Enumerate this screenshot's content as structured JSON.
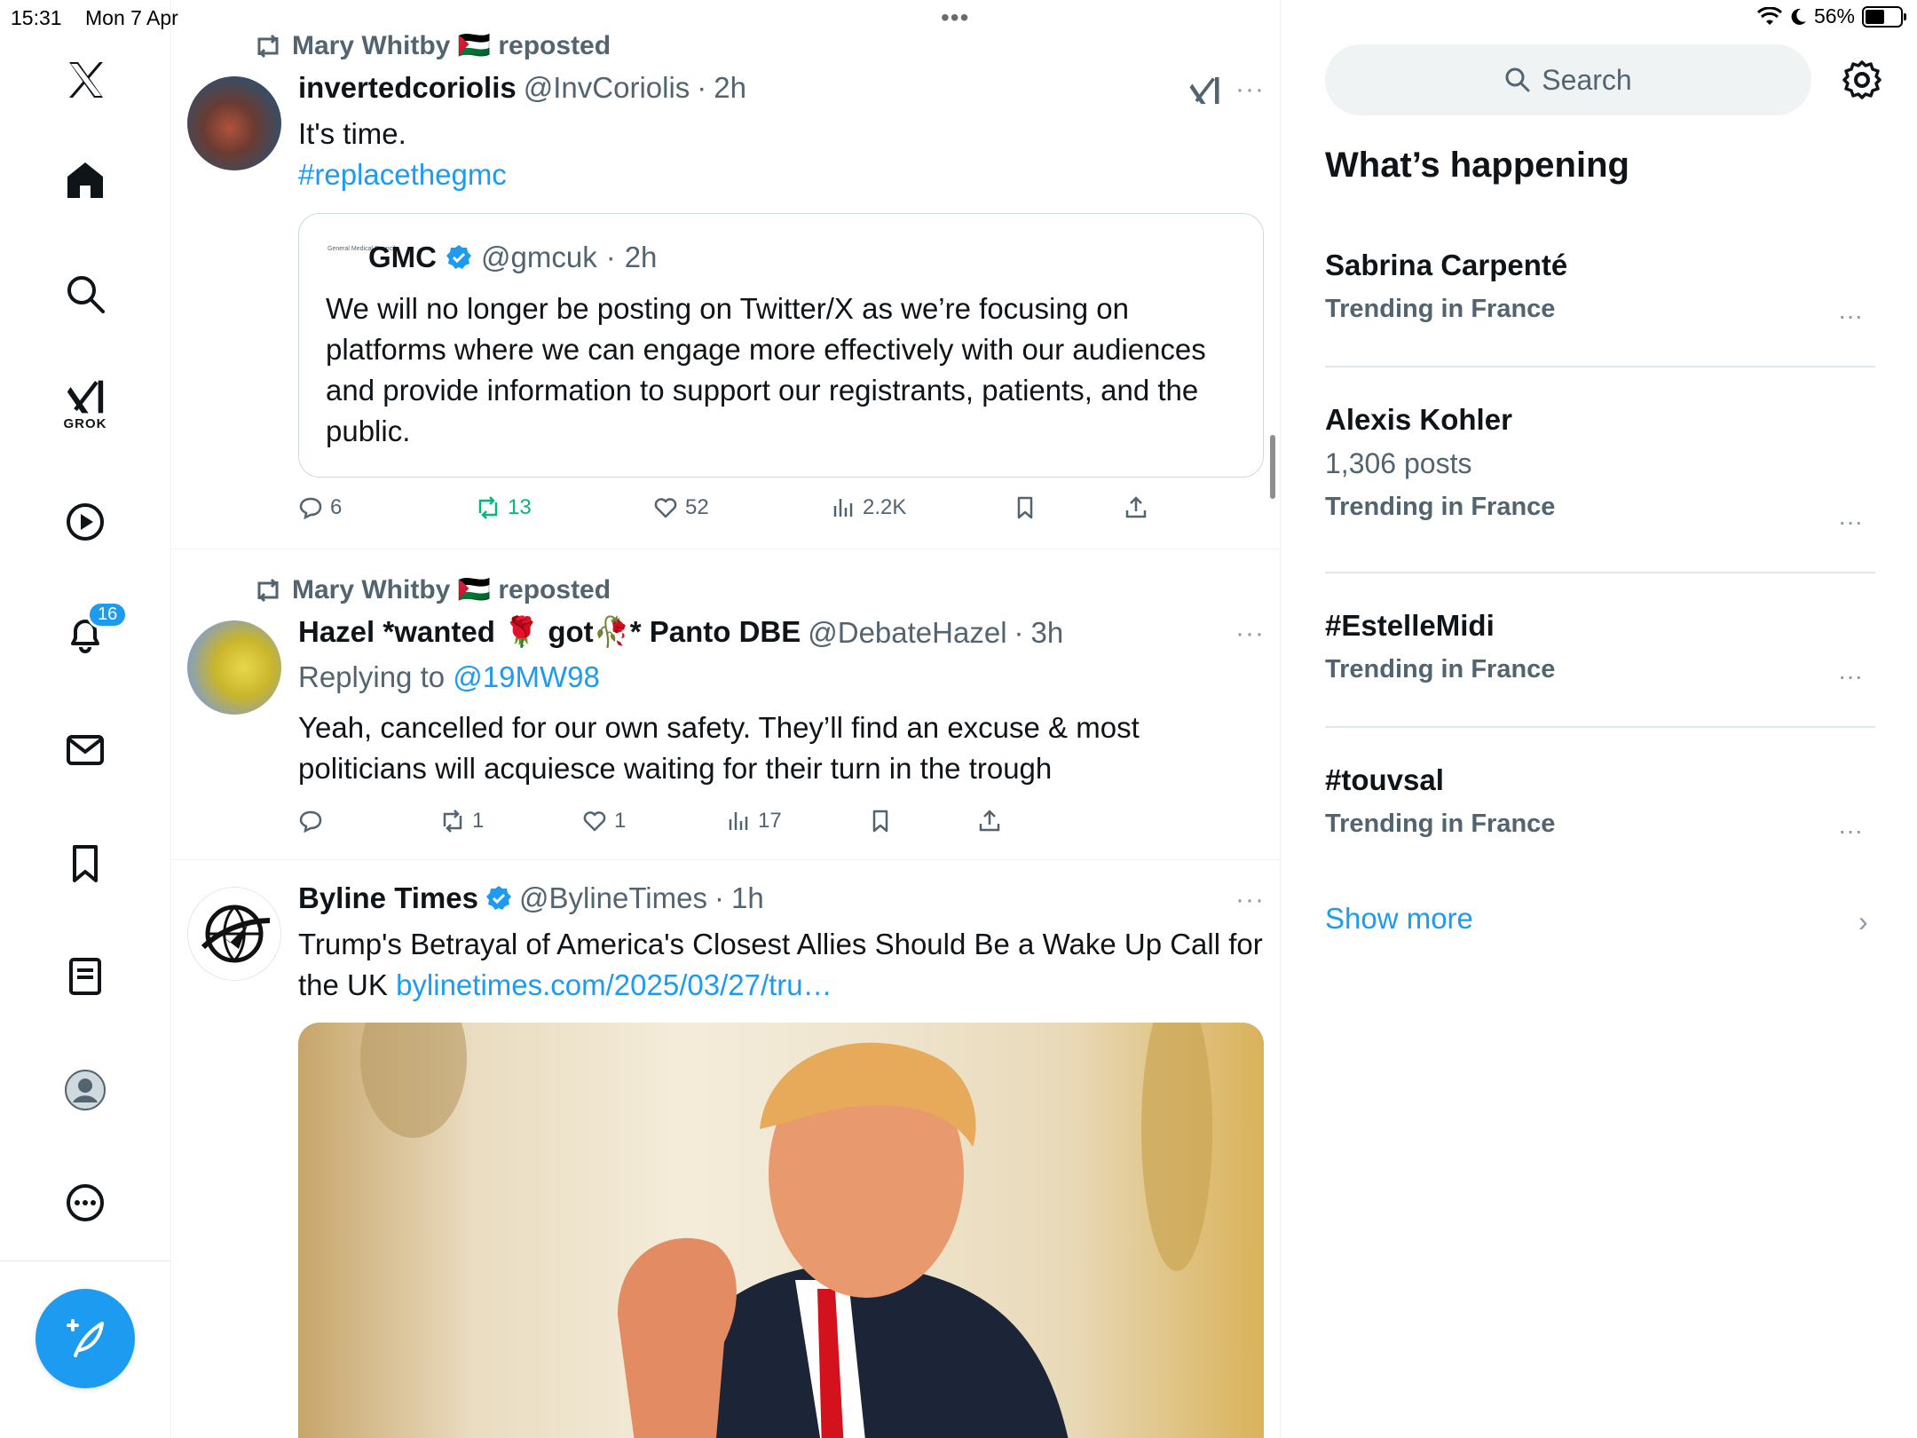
{
  "status_bar": {
    "time": "15:31",
    "date": "Mon 7 Apr",
    "battery": "56%",
    "battery_level": 0.56,
    "top_dots": "•••"
  },
  "nav": {
    "grok_label": "GROK",
    "notifications_badge": "16"
  },
  "feed": {
    "posts": [
      {
        "repost_by": "Mary Whitby 🇵🇸 reposted",
        "name": "invertedcoriolis",
        "handle": "@InvCoriolis",
        "time": "2h",
        "text": "It's time.",
        "hashtag": "#replacethegmc",
        "quote": {
          "logo_text": "General Medical Council",
          "name": "GMC",
          "handle": "@gmcuk",
          "time": "2h",
          "text": "We will no longer be posting on Twitter/X as we’re focusing on platforms where we can engage more effectively with our audiences and provide information to support our registrants, patients, and the public."
        },
        "stats": {
          "replies": "6",
          "reposts": "13",
          "likes": "52",
          "views": "2.2K"
        }
      },
      {
        "repost_by": "Mary Whitby 🇵🇸 reposted",
        "name": "Hazel *wanted 🌹 got🥀* Panto DBE",
        "handle": "@DebateHazel",
        "time": "3h",
        "replying_prefix": "Replying to",
        "replying_to": "@19MW98",
        "text": "Yeah, cancelled for our own safety.  They’ll find an excuse & most politicians will acquiesce waiting for their turn in the trough",
        "stats": {
          "replies": "",
          "reposts": "1",
          "likes": "1",
          "views": "17"
        }
      },
      {
        "name": "Byline Times",
        "handle": "@BylineTimes",
        "time": "1h",
        "text": "Trump's Betrayal of America's Closest Allies Should Be a Wake Up Call for the UK",
        "link": "bylinetimes.com/2025/03/27/tru…"
      }
    ],
    "separator": "·",
    "more": "···"
  },
  "sidebar": {
    "search_placeholder": "Search",
    "title": "What’s happening",
    "trends": [
      {
        "name": "Sabrina Carpenté",
        "posts": "",
        "context": "Trending in France"
      },
      {
        "name": "Alexis Kohler",
        "posts": "1,306 posts",
        "context": "Trending in France"
      },
      {
        "name": "#EstelleMidi",
        "posts": "",
        "context": "Trending in France"
      },
      {
        "name": "#touvsal",
        "posts": "",
        "context": "Trending in France"
      }
    ],
    "show_more": "Show more",
    "more": "···",
    "chevron": "›"
  },
  "colors": {
    "accent": "#1d9bf0",
    "secondary_text": "#536471",
    "repost_green": "#00ba7c"
  },
  "icons": [
    "x-logo-icon",
    "home-icon",
    "search-icon",
    "grok-icon",
    "video-icon",
    "bell-icon",
    "mail-icon",
    "bookmark-icon",
    "lists-icon",
    "profile-icon",
    "more-icon",
    "compose-icon",
    "repost-icon",
    "verified-icon",
    "reply-icon",
    "like-icon",
    "views-icon",
    "share-icon",
    "gear-icon"
  ]
}
